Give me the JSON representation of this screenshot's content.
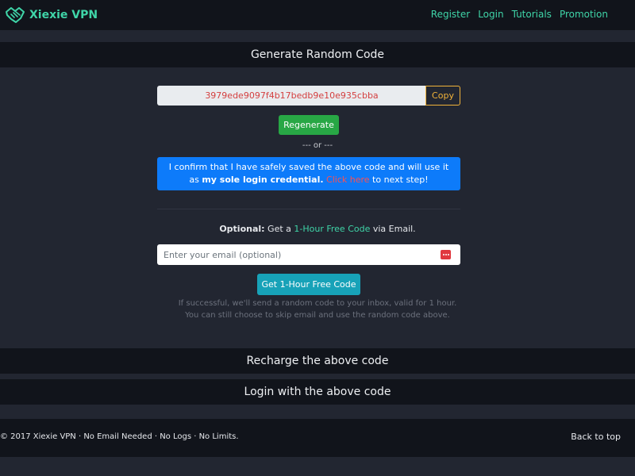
{
  "navbar": {
    "brand": "Xiexie VPN",
    "links": [
      "Register",
      "Login",
      "Tutorials",
      "Promotion"
    ]
  },
  "generate": {
    "title": "Generate Random Code",
    "code": "3979ede9097f4b17bedb9e10e935cbba",
    "copy_label": "Copy",
    "regenerate_label": "Regenerate",
    "or_text": "--- or ---",
    "confirm": {
      "text1": "I confirm that I have safely saved the above code and will use it as ",
      "bold": "my sole login credential.",
      "link": " Click here",
      "text2": " to next step!"
    }
  },
  "optional": {
    "label": "Optional:",
    "text1": " Get a ",
    "accent": "1-Hour Free Code",
    "text2": " via Email.",
    "email_placeholder": "Enter your email (optional)",
    "button_label": "Get 1-Hour Free Code",
    "hint1": "If successful, we'll send a random code to your inbox, valid for 1 hour.",
    "hint2": "You can still choose to skip email and use the random code above."
  },
  "sections": {
    "recharge": "Recharge the above code",
    "login": "Login with the above code"
  },
  "footer": {
    "copyright": "© 2017 Xiexie VPN · No Email Needed · No Logs · No Limits.",
    "back_to_top": "Back to top"
  },
  "colors": {
    "accent": "#3fd5a8",
    "background": "#222631",
    "header_bg": "#11141b",
    "confirm_bg": "#0d7bfa",
    "regenerate_bg": "#28a745",
    "free_code_bg": "#17a2b8",
    "copy_border": "#f1b33a",
    "code_text": "#d43f3f"
  },
  "icons": {
    "brand": "handshake-icon",
    "password_manager": "password-dots-icon"
  }
}
